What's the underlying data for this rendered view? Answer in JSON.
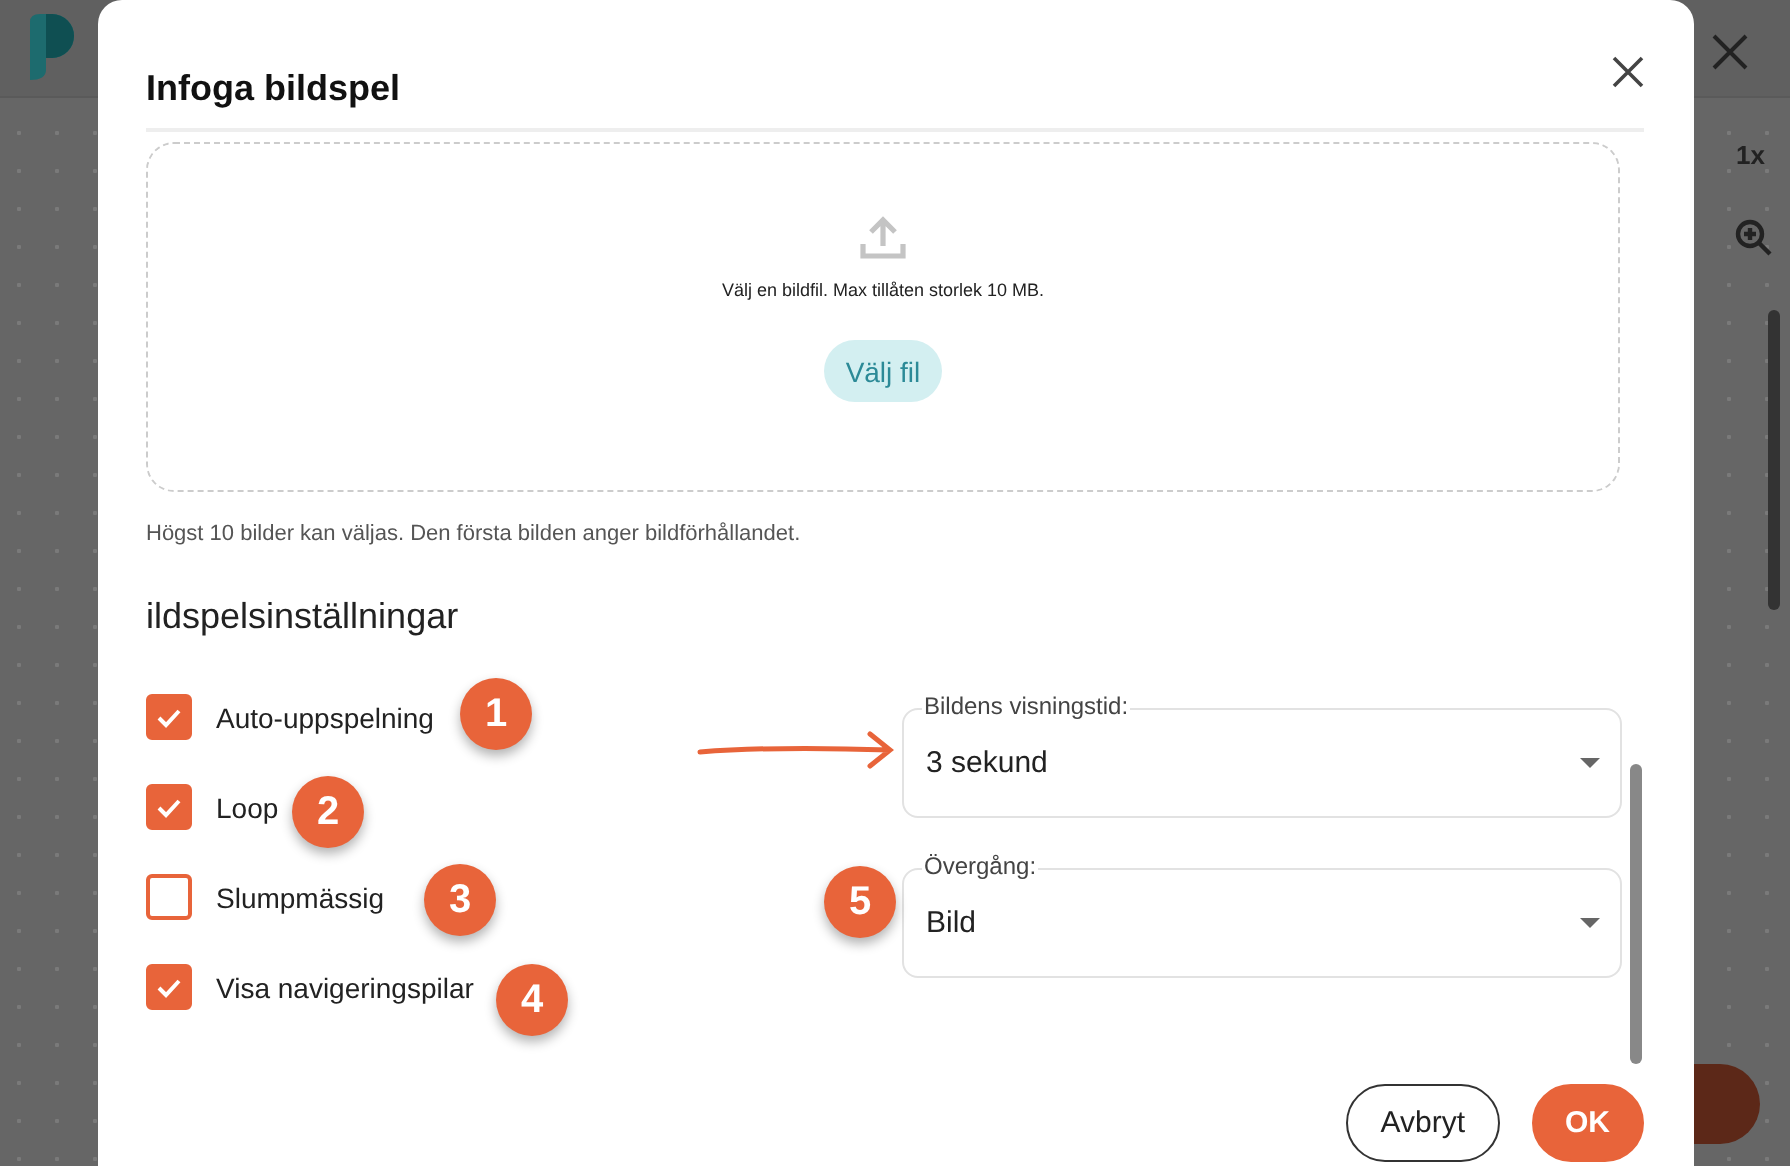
{
  "background": {
    "zoom_label": "1x"
  },
  "dialog": {
    "title": "Infoga bildspel",
    "upload": {
      "text": "Välj en bildfil. Max tillåten storlek 10 MB.",
      "button": "Välj fil"
    },
    "hint": "Högst 10 bilder kan väljas. Den första bilden anger bildförhållandet.",
    "settings_heading": "ildspelsinställningar",
    "options": [
      {
        "label": "Auto-uppspelning",
        "checked": true
      },
      {
        "label": "Loop",
        "checked": true
      },
      {
        "label": "Slumpmässig",
        "checked": false
      },
      {
        "label": "Visa navigeringspilar",
        "checked": true
      }
    ],
    "selects": [
      {
        "label": "Bildens visningstid:",
        "value": "3 sekund"
      },
      {
        "label": "Övergång:",
        "value": "Bild"
      }
    ],
    "buttons": [
      {
        "label": "Avbryt",
        "kind": "secondary"
      },
      {
        "label": "OK",
        "kind": "primary"
      }
    ]
  },
  "annotations": [
    {
      "number": "1"
    },
    {
      "number": "2"
    },
    {
      "number": "3"
    },
    {
      "number": "4"
    },
    {
      "number": "5"
    }
  ]
}
